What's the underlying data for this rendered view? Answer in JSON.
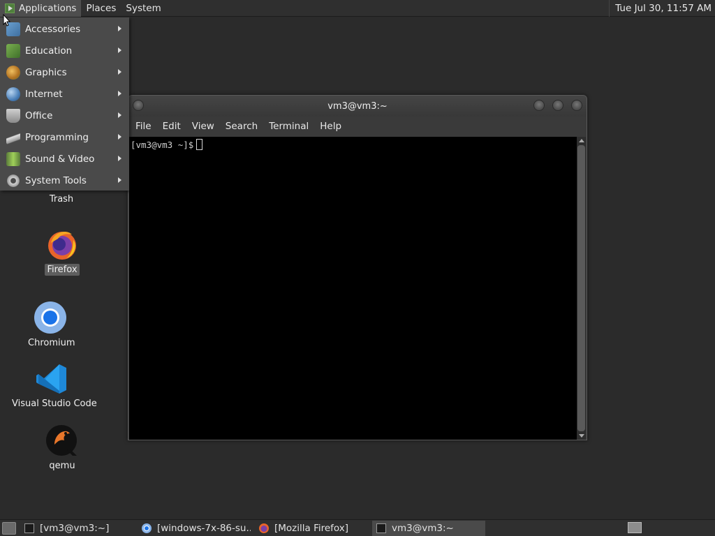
{
  "top_panel": {
    "menus": [
      {
        "label": "Applications"
      },
      {
        "label": "Places"
      },
      {
        "label": "System"
      }
    ],
    "clock": "Tue Jul 30, 11:57 AM"
  },
  "app_menu": {
    "items": [
      {
        "label": "Accessories",
        "icon": "accessories-icon",
        "color": "#6aa0d0"
      },
      {
        "label": "Education",
        "icon": "education-icon",
        "color": "#5a8f3e"
      },
      {
        "label": "Graphics",
        "icon": "graphics-icon",
        "color": "#d0a040"
      },
      {
        "label": "Internet",
        "icon": "internet-icon",
        "color": "#5a8fc8"
      },
      {
        "label": "Office",
        "icon": "office-icon",
        "color": "#b0b0b0"
      },
      {
        "label": "Programming",
        "icon": "programming-icon",
        "color": "#cfcfcf"
      },
      {
        "label": "Sound & Video",
        "icon": "sound-video-icon",
        "color": "#8fc04a"
      },
      {
        "label": "System Tools",
        "icon": "system-tools-icon",
        "color": "#c8c8c8"
      }
    ]
  },
  "desktop_icons": [
    {
      "label": "Trash",
      "icon": "trash-icon"
    },
    {
      "label": "Firefox",
      "icon": "firefox-icon"
    },
    {
      "label": "Chromium",
      "icon": "chromium-icon"
    },
    {
      "label": "Visual Studio Code",
      "icon": "vscode-icon"
    },
    {
      "label": "qemu",
      "icon": "qemu-icon"
    }
  ],
  "terminal": {
    "title": "vm3@vm3:~",
    "menu": [
      "File",
      "Edit",
      "View",
      "Search",
      "Terminal",
      "Help"
    ],
    "prompt": "[vm3@vm3 ~]$"
  },
  "taskbar": {
    "tasks": [
      {
        "label": "[vm3@vm3:~]",
        "icon": "terminal-icon"
      },
      {
        "label": "[windows-7x-86-su...",
        "icon": "chromium-icon"
      },
      {
        "label": "[Mozilla Firefox]",
        "icon": "firefox-icon"
      },
      {
        "label": "vm3@vm3:~",
        "icon": "terminal-icon"
      }
    ]
  }
}
